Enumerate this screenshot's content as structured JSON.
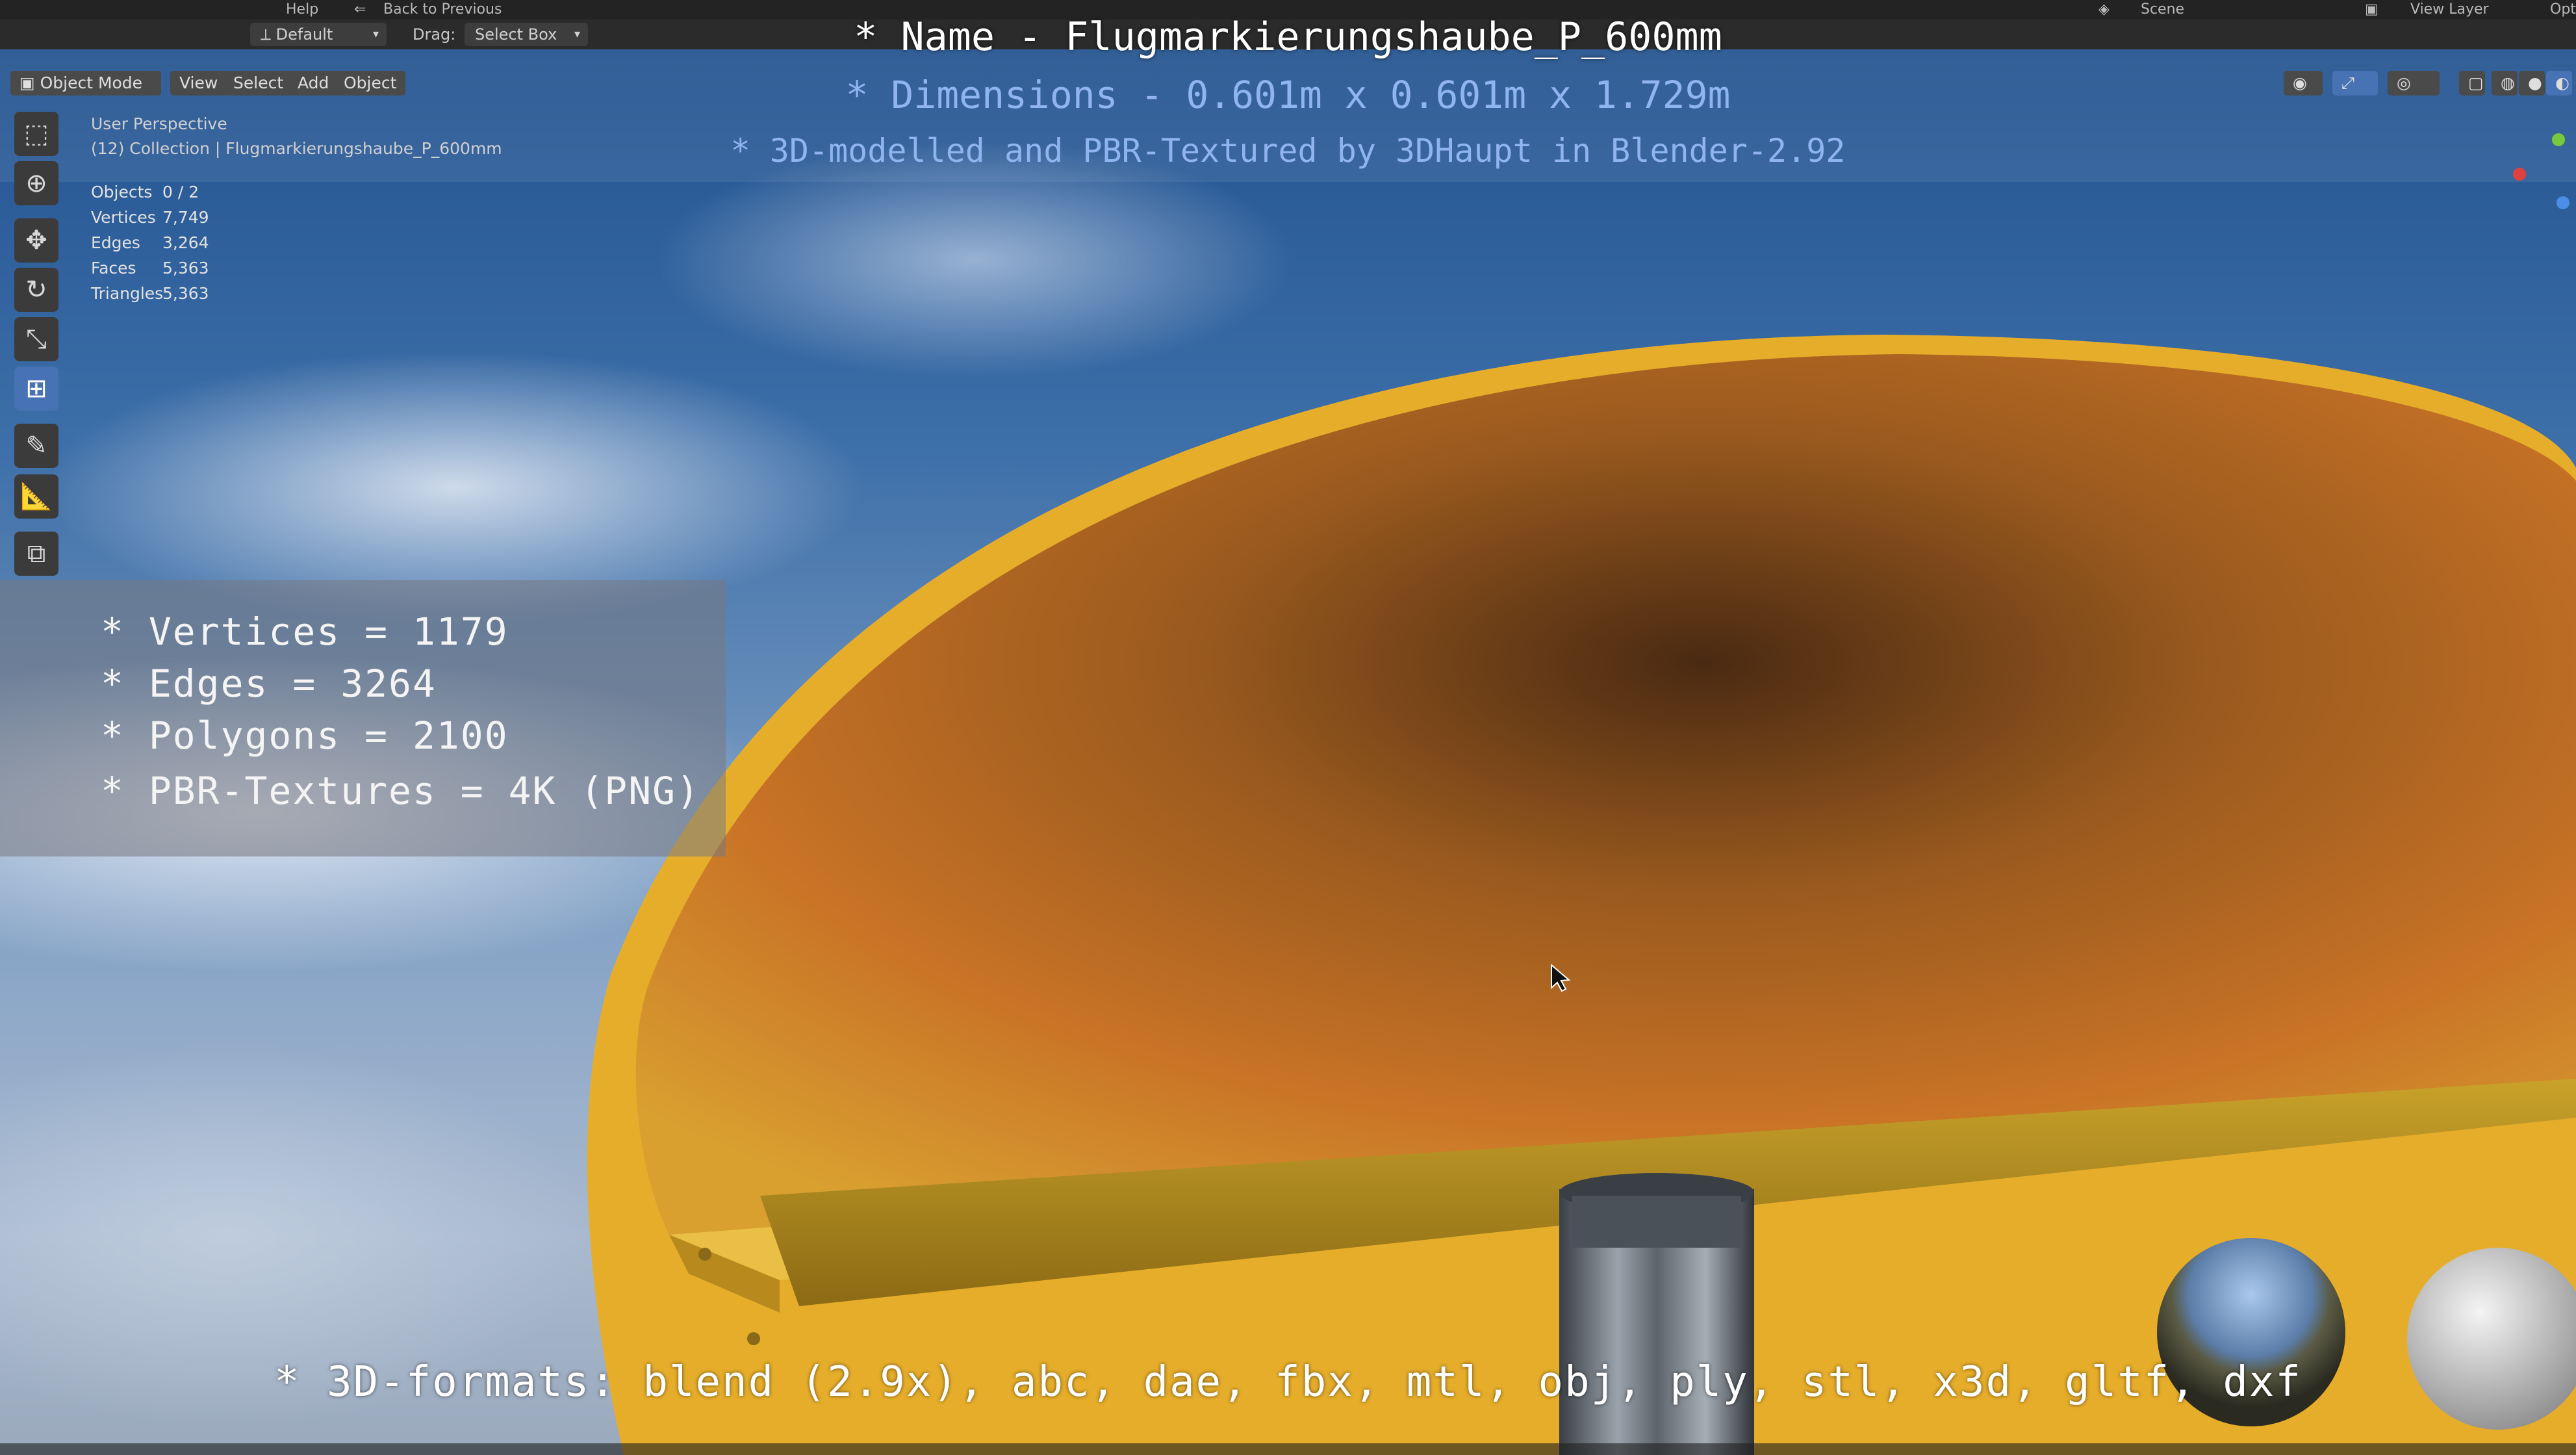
{
  "window": {
    "menu_items": [
      "Help"
    ],
    "back_button": "Back to Previous",
    "scene_label": "Scene",
    "view_layer_label": "View Layer",
    "options_label": "Opti"
  },
  "header": {
    "orientation_preset": "Default",
    "drag_label": "Drag:",
    "drag_value": "Select Box"
  },
  "viewport_header": {
    "mode": "Object Mode",
    "menus": [
      "View",
      "Select",
      "Add",
      "Object"
    ]
  },
  "overlay_title": {
    "name_line": "* Name - Flugmarkierungshaube_P_600mm",
    "dimensions_line": "* Dimensions -  0.601m x 0.601m x 1.729m",
    "credit_line": "* 3D-modelled and PBR-Textured by 3DHaupt in Blender-2.92",
    "name_color": "#ffffff",
    "accent_color": "#8fb4f0"
  },
  "viewport_text": {
    "perspective": "User Perspective",
    "collection": "(12) Collection | Flugmarkierungshaube_P_600mm"
  },
  "stats": [
    {
      "label": "Objects",
      "value": "0 / 2"
    },
    {
      "label": "Vertices",
      "value": "7,749"
    },
    {
      "label": "Edges",
      "value": "3,264"
    },
    {
      "label": "Faces",
      "value": "5,363"
    },
    {
      "label": "Triangles",
      "value": "5,363"
    }
  ],
  "info_panel": [
    "* Vertices = 1179",
    "* Edges = 3264",
    "* Polygons = 2100",
    "* PBR-Textures = 4K (PNG)"
  ],
  "formats_line": "* 3D-formats: blend (2.9x), abc, dae, fbx, mtl, obj, ply, stl, x3d, gltf, dxf",
  "toolbar_icons": [
    "select-box-icon",
    "cursor-icon",
    "move-icon",
    "rotate-icon",
    "scale-icon",
    "transform-icon",
    "annotate-icon",
    "measure-icon",
    "add-cube-icon"
  ],
  "colors": {
    "cover_yellow": "#e0a826",
    "cover_inner_orange": "#c56a1c",
    "active_tool_blue": "#4772b3"
  }
}
